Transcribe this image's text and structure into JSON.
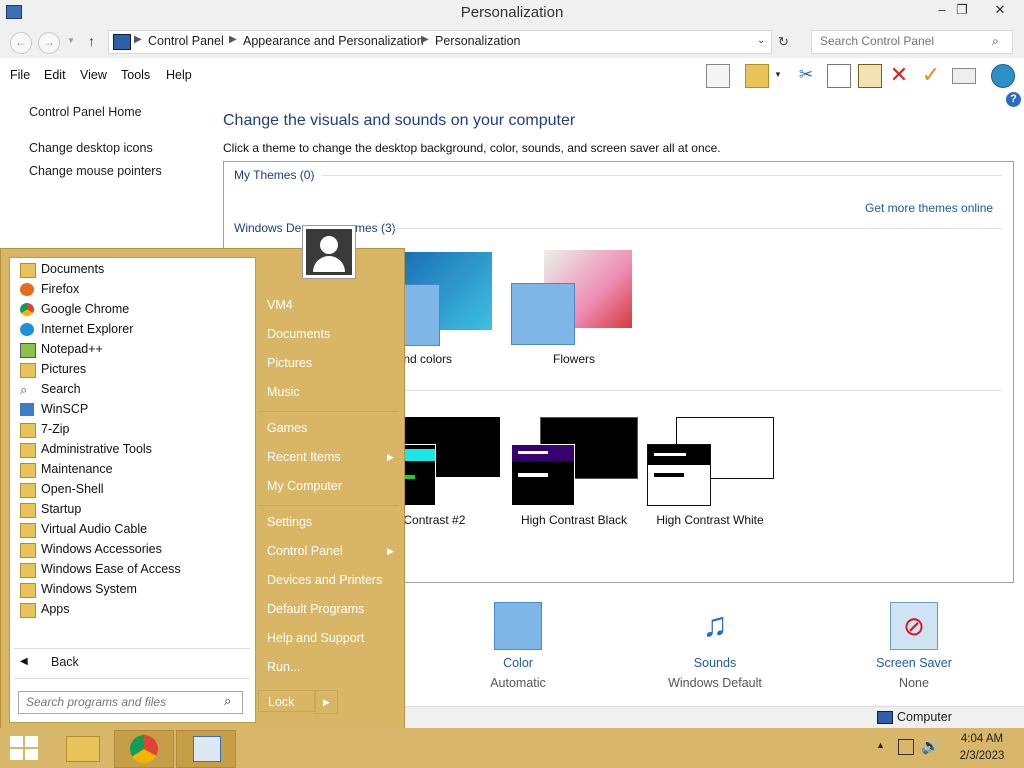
{
  "window": {
    "title": "Personalization",
    "minimize": "–",
    "maximize": "❐",
    "close": "✕"
  },
  "address": {
    "crumbs": [
      "Control Panel",
      "Appearance and Personalization",
      "Personalization"
    ],
    "search_placeholder": "Search Control Panel"
  },
  "menu": [
    "File",
    "Edit",
    "View",
    "Tools",
    "Help"
  ],
  "left_pane": {
    "home": "Control Panel Home",
    "links": [
      "Change desktop icons",
      "Change mouse pointers"
    ]
  },
  "main": {
    "heading": "Change the visuals and sounds on your computer",
    "subtext": "Click a theme to change the desktop background, color, sounds, and screen saver all at once.",
    "my_themes": "My Themes (0)",
    "get_more": "Get more themes online",
    "windows_default_a": "Windows De",
    "windows_default_b": "mes (3)",
    "themes_default": [
      {
        "label": "nes and colors"
      },
      {
        "label": "Flowers"
      }
    ],
    "themes_hc": [
      {
        "label": "igh Contrast #2"
      },
      {
        "label": "High Contrast Black"
      },
      {
        "label": "High Contrast White"
      }
    ]
  },
  "bottom": [
    {
      "label": "Color",
      "sub": "Automatic",
      "icon": "color-icon"
    },
    {
      "label": "Sounds",
      "sub": "Windows Default",
      "icon": "sounds-icon"
    },
    {
      "label": "Screen Saver",
      "sub": "None",
      "icon": "screen-saver-icon"
    }
  ],
  "status": {
    "computer": "Computer"
  },
  "start_menu": {
    "programs": [
      "Documents",
      "Firefox",
      "Google Chrome",
      "Internet Explorer",
      "Notepad++",
      "Pictures",
      "Search",
      "WinSCP",
      "7-Zip",
      "Administrative Tools",
      "Maintenance",
      "Open-Shell",
      "Startup",
      "Virtual Audio Cable",
      "Windows Accessories",
      "Windows Ease of Access",
      "Windows System",
      "Apps"
    ],
    "back": "Back",
    "search_placeholder": "Search programs and files",
    "right_items": [
      "VM4",
      "Documents",
      "Pictures",
      "Music",
      "Games",
      "Recent Items",
      "My Computer",
      "Settings",
      "Control Panel",
      "Devices and Printers",
      "Default Programs",
      "Help and Support",
      "Run..."
    ],
    "lock": "Lock"
  },
  "taskbar": {
    "time": "4:04 AM",
    "date": "2/3/2023"
  },
  "colors": {
    "start_menu_bg": "#d8b665",
    "taskbar_bg": "#d8b76b",
    "link_blue": "#1e3d87"
  }
}
